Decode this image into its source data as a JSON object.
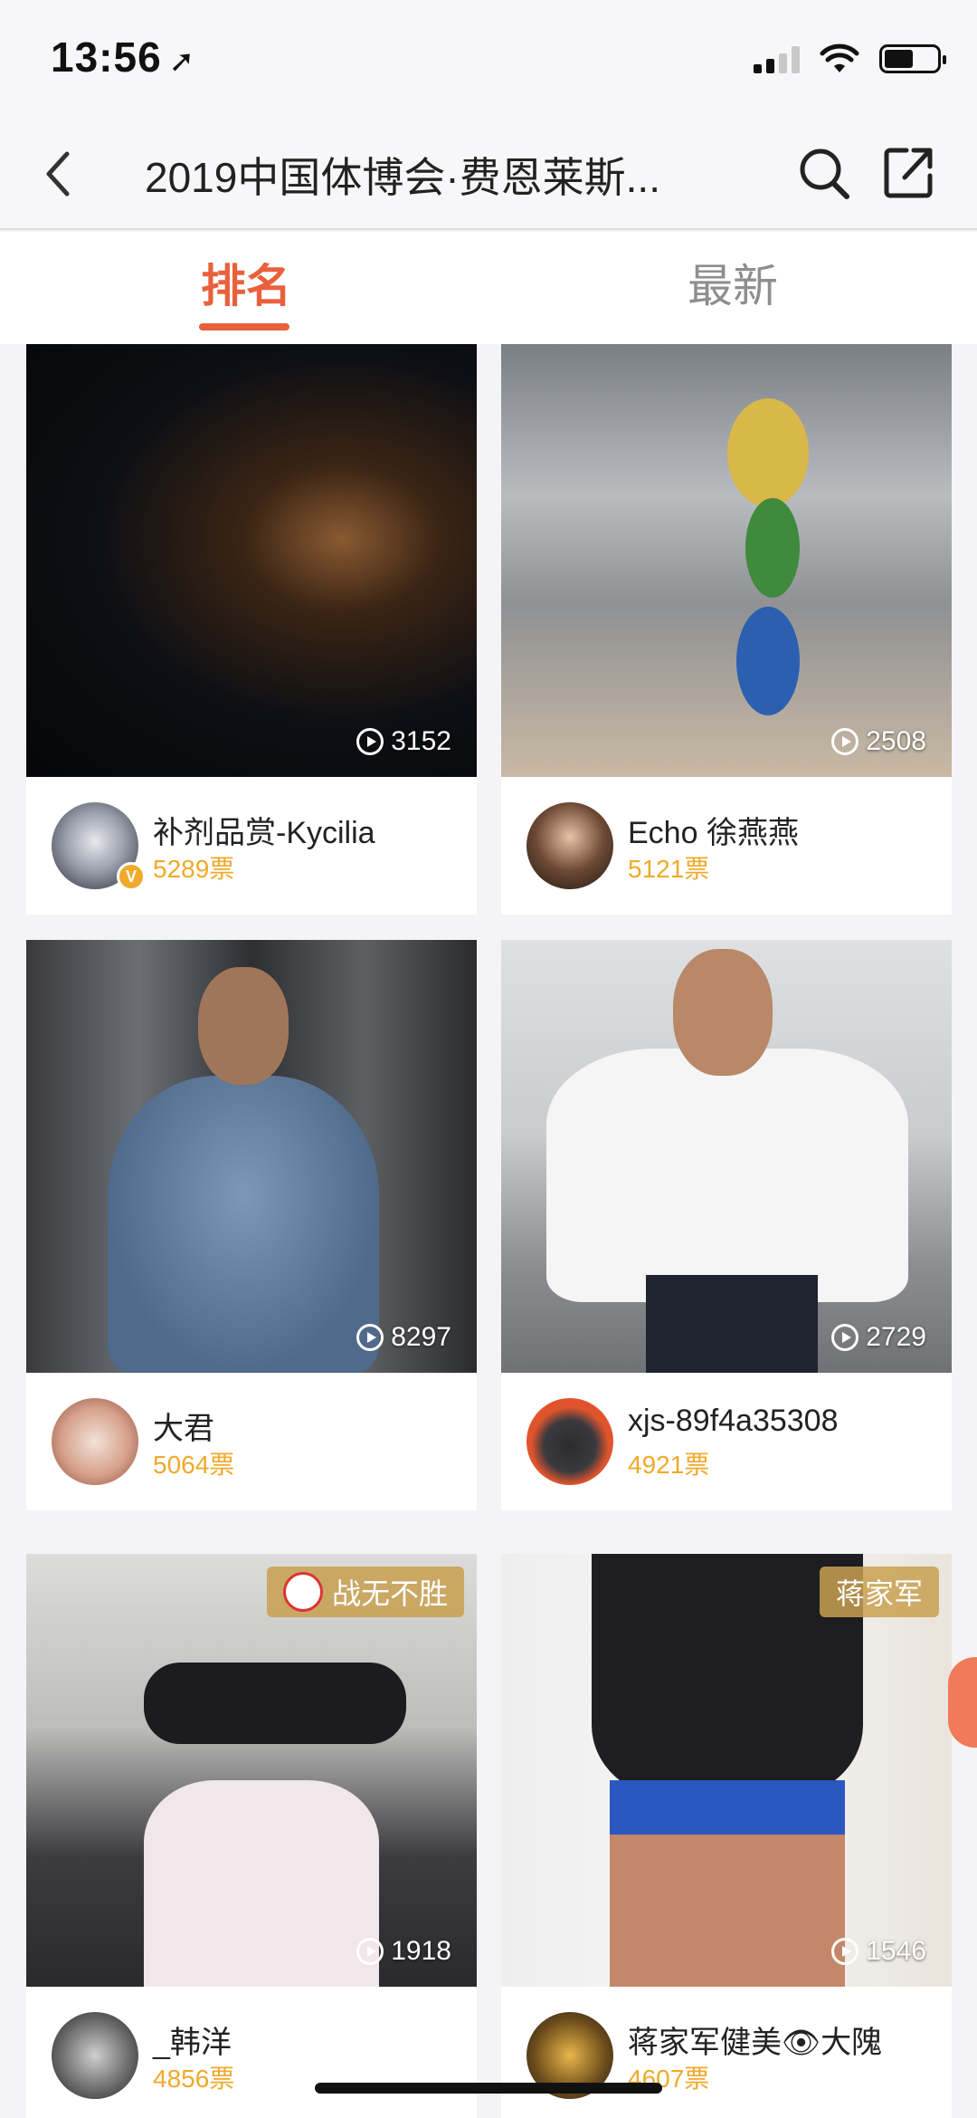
{
  "status": {
    "time": "13:56"
  },
  "nav": {
    "title": "2019中国体博会·费恩莱斯..."
  },
  "tabs": [
    {
      "label": "排名",
      "active": true
    },
    {
      "label": "最新",
      "active": false
    }
  ],
  "colors": {
    "accent": "#e8613c",
    "votes": "#f0a92a",
    "tag_bg": "#c8a050"
  },
  "cards": [
    {
      "views": "3152",
      "user": "补剂品赏-Kycilia",
      "votes": "5289票",
      "verified": true,
      "tag": ""
    },
    {
      "views": "2508",
      "user": "Echo 徐燕燕",
      "votes": "5121票",
      "verified": false,
      "tag": ""
    },
    {
      "views": "8297",
      "user": "大君",
      "votes": "5064票",
      "verified": false,
      "tag": ""
    },
    {
      "views": "2729",
      "user": "xjs-89f4a35308",
      "votes": "4921票",
      "verified": false,
      "tag": ""
    },
    {
      "views": "1918",
      "user": "_韩洋",
      "votes": "4856票",
      "verified": false,
      "tag": "战无不胜"
    },
    {
      "views": "1546",
      "user": "蒋家军健美👁大隗",
      "votes": "4607票",
      "verified": false,
      "tag": "蒋家军"
    }
  ]
}
